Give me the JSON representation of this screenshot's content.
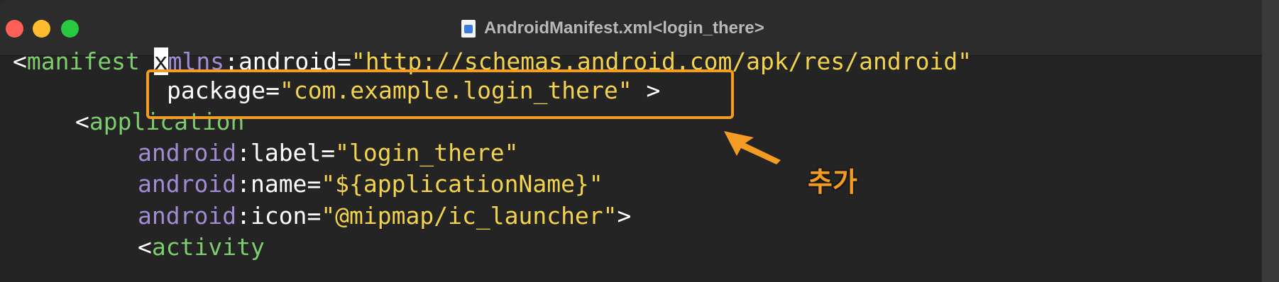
{
  "window": {
    "title": "AndroidManifest.xml<login_there>",
    "file_icon": "xml-file-icon",
    "traffic_lights": {
      "close_color": "#ff5f57",
      "minimize_color": "#febc2e",
      "maximize_color": "#28c840"
    }
  },
  "code": {
    "line1": {
      "open": "<",
      "tag": "manifest",
      "space": " ",
      "cursor_char": "x",
      "attr_ns": "mlns",
      "colon": ":",
      "attr": "android",
      "eq": "=",
      "value": "\"http://schemas.android.com/apk/res/android\""
    },
    "line2": {
      "attr": "package",
      "eq": "=",
      "value": "\"com.example.login_there\"",
      "close": " >"
    },
    "line3": {
      "open": "<",
      "tag": "application"
    },
    "line4": {
      "ns": "android",
      "colon": ":",
      "attr": "label",
      "eq": "=",
      "value": "\"login_there\""
    },
    "line5": {
      "ns": "android",
      "colon": ":",
      "attr": "name",
      "eq": "=",
      "value": "\"${applicationName}\""
    },
    "line6": {
      "ns": "android",
      "colon": ":",
      "attr": "icon",
      "eq": "=",
      "value": "\"@mipmap/ic_launcher\"",
      "close": ">"
    },
    "line7": {
      "open": "<",
      "tag": "activity"
    }
  },
  "annotation": {
    "label": "추가",
    "color": "#f39b23"
  }
}
